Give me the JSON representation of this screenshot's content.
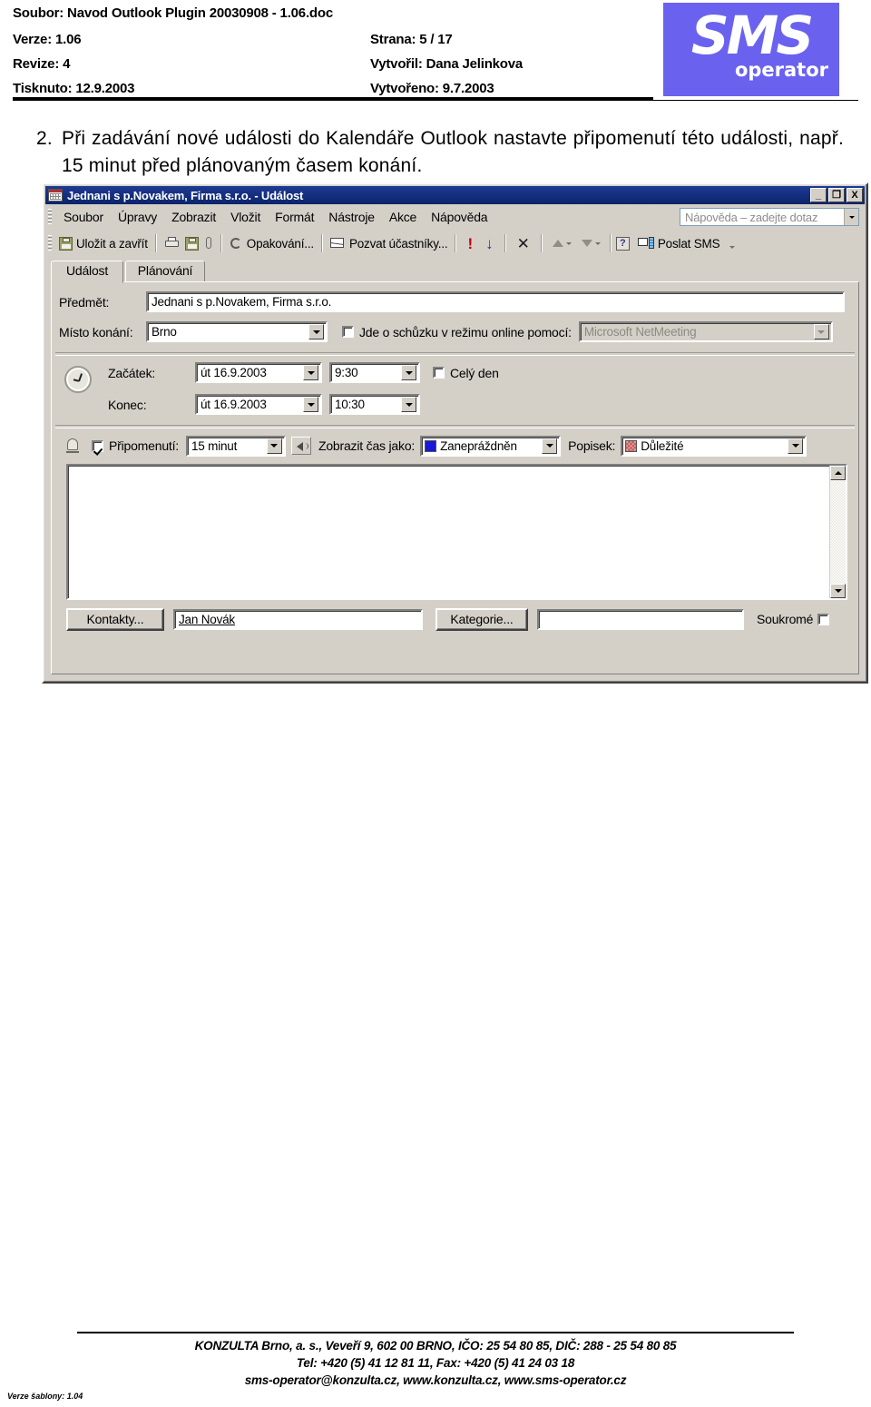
{
  "doc_header": {
    "file_line": "Soubor: Navod Outlook Plugin 20030908 - 1.06.doc",
    "version_label": "Verze: 1.06",
    "page_label": "Strana: 5 / 17",
    "revision_label": "Revize: 4",
    "author_label": "Vytvořil: Dana Jelinkova",
    "printed_label": "Tisknuto: 12.9.2003",
    "created_label": "Vytvořeno: 9.7.2003",
    "logo": {
      "main": "SMS",
      "sub": "operator",
      "bg_color": "#6a62ef"
    }
  },
  "instruction": {
    "number": "2.",
    "text": "Při zadávání nové události do Kalendáře Outlook nastavte připomenutí této události, např. 15 minut před plánovaným časem konání."
  },
  "outlook": {
    "titlebar": {
      "title": "Jednani s p.Novakem, Firma s.r.o. - Událost",
      "minimize": "_",
      "maximize": "❐",
      "close": "X"
    },
    "menu": [
      "Soubor",
      "Úpravy",
      "Zobrazit",
      "Vložit",
      "Formát",
      "Nástroje",
      "Akce",
      "Nápověda"
    ],
    "help_search_placeholder": "Nápověda – zadejte dotaz",
    "toolbar": {
      "save_close": "Uložit a zavřít",
      "recurrence": "Opakování...",
      "invite": "Pozvat účastníky...",
      "importance_high": "!",
      "importance_low": "↓",
      "cancel_invite": "✕",
      "send_sms": "Poslat SMS",
      "help": "?"
    },
    "tabs": [
      {
        "label": "Událost",
        "active": true
      },
      {
        "label": "Plánování",
        "active": false
      }
    ],
    "form": {
      "subject_label": "Předmět:",
      "subject_value": "Jednani s p.Novakem, Firma s.r.o.",
      "location_label": "Místo konání:",
      "location_value": "Brno",
      "online_checkbox_label": "Jde o schůzku v režimu online pomocí:",
      "online_checked": false,
      "online_service_value": "Microsoft NetMeeting",
      "start_label": "Začátek:",
      "start_date": "út 16.9.2003",
      "start_time": "9:30",
      "end_label": "Konec:",
      "end_date": "út 16.9.2003",
      "end_time": "10:30",
      "all_day_label": "Celý den",
      "all_day_checked": false,
      "reminder_label": "Připomenutí:",
      "reminder_checked": true,
      "reminder_value": "15 minut",
      "show_time_as_label": "Zobrazit čas jako:",
      "show_time_as_value": "Zanepráždněn",
      "show_time_as_color": "#1818d8",
      "label_label": "Popisek:",
      "label_value": "Důležité",
      "label_color": "#e9a4a4",
      "notes_value": "",
      "contacts_button": "Kontakty...",
      "contacts_value": "Jan Novák",
      "categories_button": "Kategorie...",
      "categories_value": "",
      "private_label": "Soukromé",
      "private_checked": false
    }
  },
  "doc_footer": {
    "line1": "KONZULTA Brno, a. s., Veveří 9, 602 00 BRNO, IČO: 25 54 80 85, DIČ: 288 - 25 54 80 85",
    "line2": "Tel: +420 (5) 41 12 81 11, Fax: +420 (5) 41 24 03 18",
    "line3": "sms-operator@konzulta.cz, www.konzulta.cz, www.sms-operator.cz",
    "template_version": "Verze šablony: 1.04"
  }
}
